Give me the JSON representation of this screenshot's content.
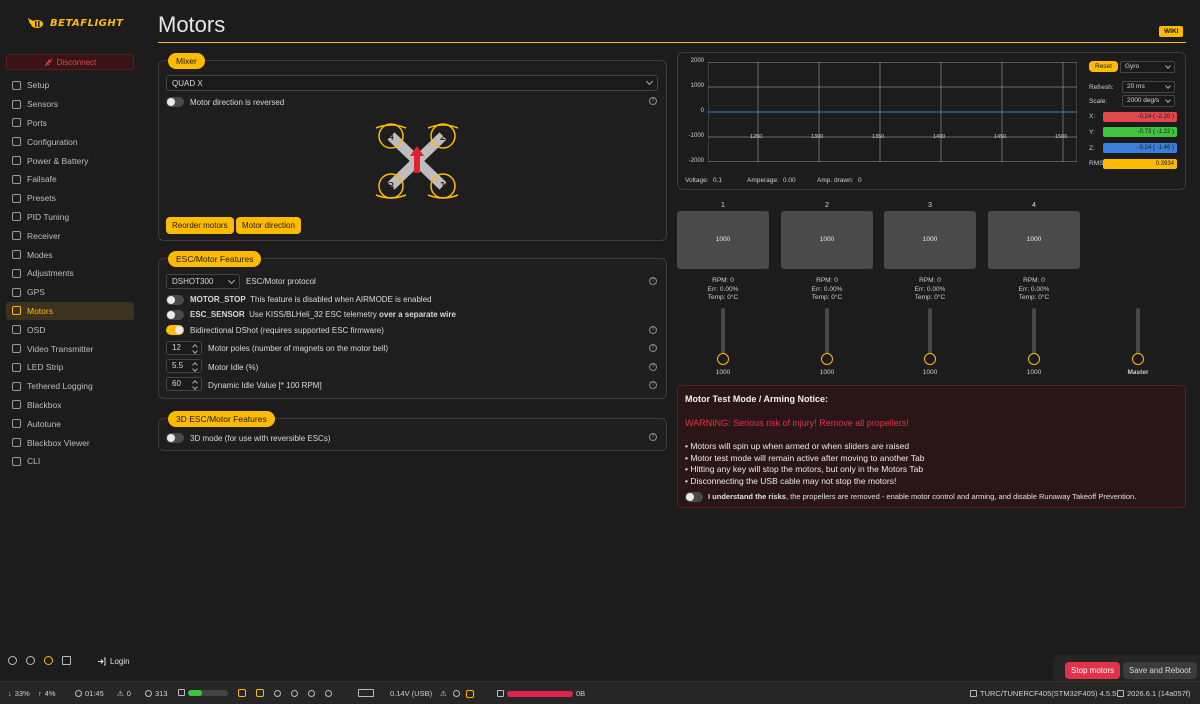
{
  "app": {
    "name": "BETAFLIGHT"
  },
  "header": {
    "title": "Motors",
    "wiki_label": "WIKI"
  },
  "sidebar": {
    "disconnect_label": "Disconnect",
    "items": [
      {
        "label": "Setup",
        "icon": "setup-icon"
      },
      {
        "label": "Sensors",
        "icon": "sensors-icon"
      },
      {
        "label": "Ports",
        "icon": "ports-icon"
      },
      {
        "label": "Configuration",
        "icon": "configuration-icon"
      },
      {
        "label": "Power & Battery",
        "icon": "battery-icon"
      },
      {
        "label": "Failsafe",
        "icon": "failsafe-icon"
      },
      {
        "label": "Presets",
        "icon": "presets-icon"
      },
      {
        "label": "PID Tuning",
        "icon": "pid-icon"
      },
      {
        "label": "Receiver",
        "icon": "receiver-icon"
      },
      {
        "label": "Modes",
        "icon": "modes-icon"
      },
      {
        "label": "Adjustments",
        "icon": "adjustments-icon"
      },
      {
        "label": "GPS",
        "icon": "gps-icon"
      },
      {
        "label": "Motors",
        "icon": "motors-icon",
        "active": true
      },
      {
        "label": "OSD",
        "icon": "osd-icon"
      },
      {
        "label": "Video Transmitter",
        "icon": "vtx-icon"
      },
      {
        "label": "LED Strip",
        "icon": "led-icon"
      },
      {
        "label": "Tethered Logging",
        "icon": "tethered-icon"
      },
      {
        "label": "Blackbox",
        "icon": "blackbox-icon"
      },
      {
        "label": "Autotune",
        "icon": "autotune-icon"
      },
      {
        "label": "Blackbox Viewer",
        "icon": "viewer-icon"
      },
      {
        "label": "CLI",
        "icon": "cli-icon"
      }
    ],
    "login_label": "Login"
  },
  "mixer": {
    "tag": "Mixer",
    "selected": "QUAD X",
    "reversed_label": "Motor direction is reversed",
    "motor_numbers": [
      "4",
      "2",
      "3",
      "1"
    ],
    "reorder_label": "Reorder motors",
    "direction_label": "Motor direction"
  },
  "esc": {
    "tag": "ESC/Motor Features",
    "protocol_value": "DSHOT300",
    "protocol_label": "ESC/Motor protocol",
    "motor_stop_name": "MOTOR_STOP",
    "motor_stop_desc": "This feature is disabled when AIRMODE is enabled",
    "esc_sensor_name": "ESC_SENSOR",
    "esc_sensor_desc": "Use KISS/BLHeli_32 ESC telemetry",
    "esc_sensor_bold": "over a separate wire",
    "bidir_label": "Bidirectional DShot (requires supported ESC firmware)",
    "poles_value": "12",
    "poles_label": "Motor poles (number of magnets on the motor bell)",
    "idle_value": "5.5",
    "idle_label": "Motor Idle (%)",
    "dyn_idle_value": "60",
    "dyn_idle_label": "Dynamic Idle Value [* 100 RPM]"
  },
  "features3d": {
    "tag": "3D ESC/Motor Features",
    "mode_label": "3D mode (for use with reversible ESCs)"
  },
  "graph": {
    "reset_label": "Reset",
    "sensor": "Gyro",
    "refresh_label": "Refresh:",
    "refresh_value": "20 ms",
    "scale_label": "Scale:",
    "scale_value": "2000 deg/s",
    "x_label": "X:",
    "x_value": "-0.24 ( -2.20 )",
    "y_label": "Y:",
    "y_value": "-0.73 ( -1.22 )",
    "z_label": "Z:",
    "z_value": "-0.24 ( -1.46 )",
    "rms_label": "RMS:",
    "rms_value": "0.3934",
    "colors": {
      "x": "#e2474b",
      "y": "#3ec53e",
      "z": "#3b7dd8",
      "rms": "#ffbb00"
    },
    "voltage_label": "Voltage:",
    "voltage_value": "0.1",
    "amperage_label": "Amperage:",
    "amperage_value": "0.00",
    "drawn_label": "Amp. drawn:",
    "drawn_value": "0"
  },
  "chart_data": {
    "type": "line",
    "y_ticks": [
      "2000",
      "1000",
      "0",
      "-1000",
      "-2000"
    ],
    "x_ticks": [
      "1250",
      "1300",
      "1350",
      "1400",
      "1450",
      "1500"
    ],
    "ylim": [
      -2000,
      2000
    ],
    "series": [
      {
        "values": [
          0,
          0
        ]
      }
    ]
  },
  "motors": [
    {
      "id": "1",
      "value": "1000",
      "rpm": "RPM: 0",
      "err": "Err: 0.00%",
      "temp": "Temp: 0°C",
      "slider_value": "1000"
    },
    {
      "id": "2",
      "value": "1000",
      "rpm": "RPM: 0",
      "err": "Err: 0.00%",
      "temp": "Temp: 0°C",
      "slider_value": "1000"
    },
    {
      "id": "3",
      "value": "1000",
      "rpm": "RPM: 0",
      "err": "Err: 0.00%",
      "temp": "Temp: 0°C",
      "slider_value": "1000"
    },
    {
      "id": "4",
      "value": "1000",
      "rpm": "RPM: 0",
      "err": "Err: 0.00%",
      "temp": "Temp: 0°C",
      "slider_value": "1000"
    }
  ],
  "master_label": "Master",
  "notice": {
    "title": "Motor Test Mode / Arming Notice:",
    "warning": "WARNING: Serious risk of injury! Remove all propellers!",
    "bullets": [
      "• Motors will spin up when armed or when sliders are raised",
      "• Motor test mode will remain active after moving to another Tab",
      "• Hitting any key will stop the motors, but only in the Motors Tab",
      "• Disconnecting the USB cable may not stop the motors!"
    ],
    "understand_bold": "I understand the risks",
    "understand_rest": ", the propellers are removed - enable motor control and arming, and disable Runaway Takeoff Prevention."
  },
  "actions": {
    "stop_label": "Stop motors",
    "save_label": "Save and Reboot"
  },
  "status": {
    "down": "33%",
    "up": "4%",
    "time": "01:45",
    "warn_count": "0",
    "cycle": "313",
    "voltage": "0.14V (USB)",
    "data": "0B",
    "board": "TURC/TUNERCF405(STM32F405) 4.5.5",
    "version": "2026.6.1 (14a057f)"
  }
}
